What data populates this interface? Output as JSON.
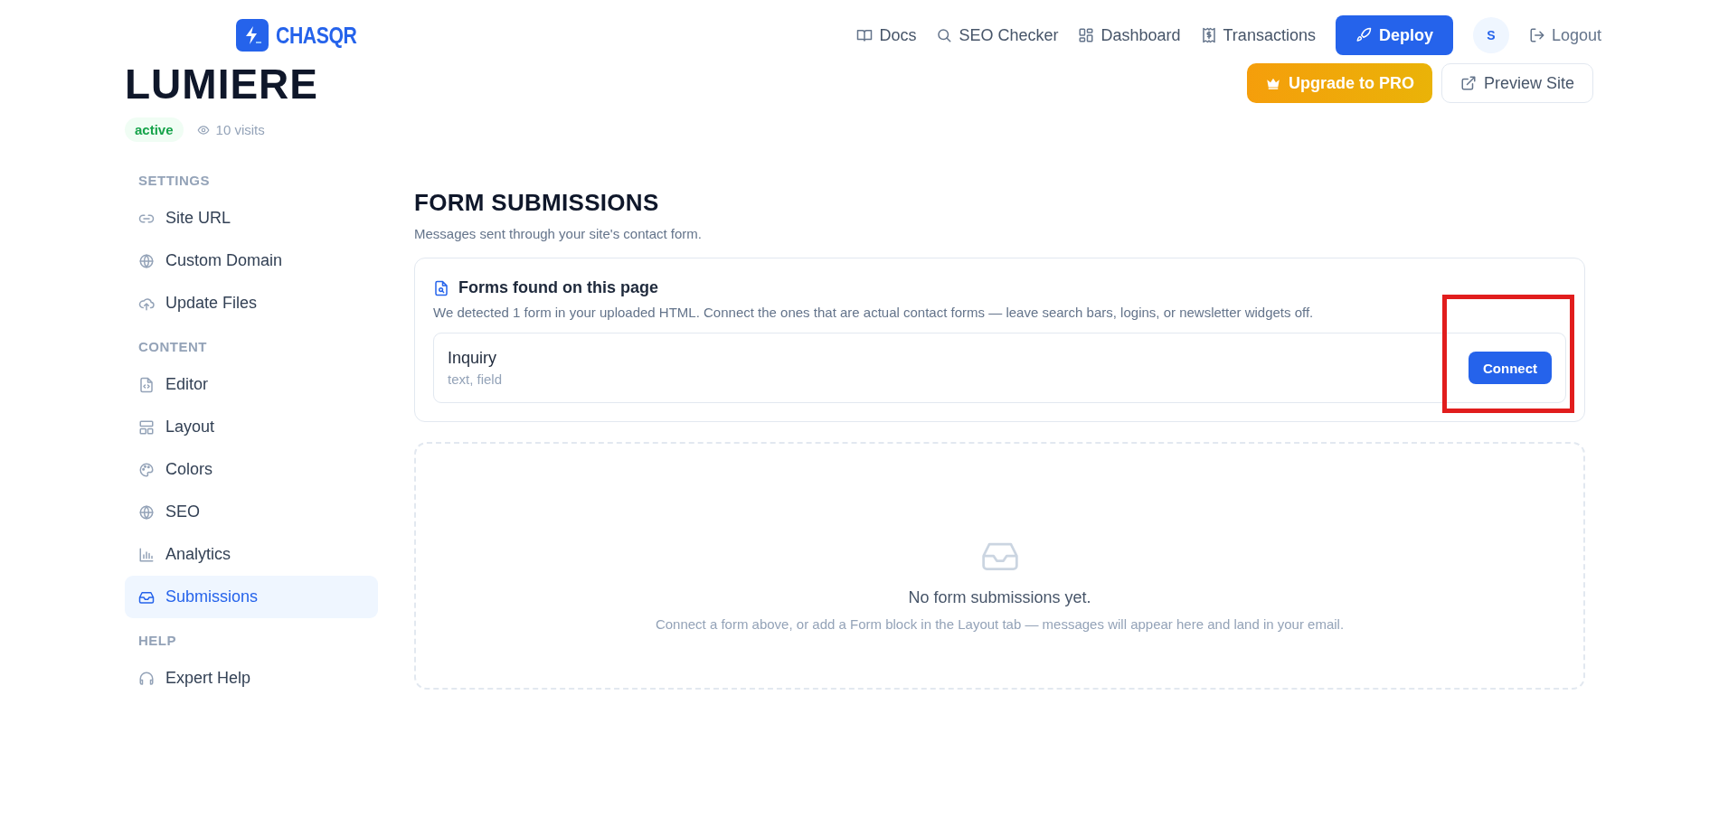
{
  "header": {
    "logo": "CHASQR",
    "nav": [
      {
        "kind": "docs",
        "label": "Docs"
      },
      {
        "kind": "search",
        "label": "SEO Checker"
      },
      {
        "kind": "dashboard",
        "label": "Dashboard"
      },
      {
        "kind": "receipt",
        "label": "Transactions"
      }
    ],
    "deploy": "Deploy",
    "avatar": "S",
    "logout": "Logout"
  },
  "site": {
    "title": "LUMIERE",
    "status": "active",
    "visits": "10 visits",
    "upgrade": "Upgrade to PRO",
    "preview": "Preview Site"
  },
  "sidebar": [
    {
      "heading": "SETTINGS",
      "items": [
        {
          "kind": "link",
          "label": "Site URL",
          "selected": false
        },
        {
          "kind": "globe",
          "label": "Custom Domain",
          "selected": false
        },
        {
          "kind": "upload",
          "label": "Update Files",
          "selected": false
        }
      ]
    },
    {
      "heading": "CONTENT",
      "items": [
        {
          "kind": "file",
          "label": "Editor",
          "selected": false
        },
        {
          "kind": "layout",
          "label": "Layout",
          "selected": false
        },
        {
          "kind": "palette",
          "label": "Colors",
          "selected": false
        },
        {
          "kind": "globe",
          "label": "SEO",
          "selected": false
        },
        {
          "kind": "chart",
          "label": "Analytics",
          "selected": false
        },
        {
          "kind": "inbox",
          "label": "Submissions",
          "selected": true
        }
      ]
    },
    {
      "heading": "HELP",
      "items": [
        {
          "kind": "headset",
          "label": "Expert Help",
          "selected": false
        }
      ]
    }
  ],
  "main": {
    "title": "FORM SUBMISSIONS",
    "subtitle": "Messages sent through your site's contact form.",
    "forms_card": {
      "title": "Forms found on this page",
      "description": "We detected 1 form in your uploaded HTML. Connect the ones that are actual contact forms — leave search bars, logins, or newsletter widgets off.",
      "forms": [
        {
          "name": "Inquiry",
          "fields": "text, field",
          "action": "Connect",
          "highlighted": true
        }
      ]
    },
    "empty": {
      "title": "No form submissions yet.",
      "description": "Connect a form above, or add a Form block in the Layout tab — messages will appear here and land in your email."
    }
  }
}
